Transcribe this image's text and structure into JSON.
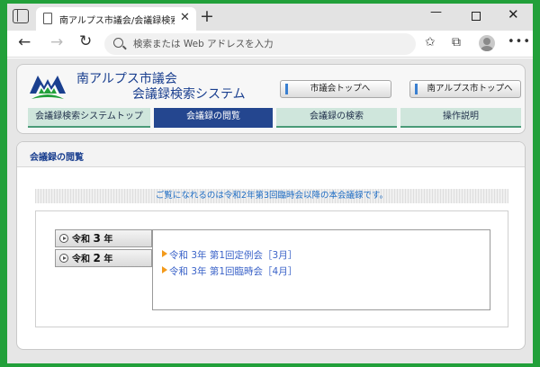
{
  "browser": {
    "tab_title": "南アルプス市議会/会議録検索シス…",
    "tab_close": "✕",
    "new_tab": "+",
    "win_min": "—",
    "win_close": "✕",
    "nav_back": "←",
    "nav_forward": "→",
    "nav_reload": "↻",
    "address_placeholder": "検索または Web アドレスを入力",
    "favorites_icon": "✩",
    "collections_icon": "⧉",
    "more_icon": "•••"
  },
  "site": {
    "title_line1": "南アルプス市議会",
    "title_line2": "会議録検索システム",
    "btn_council_top": "市議会トップへ",
    "btn_city_top": "南アルプス市トップへ",
    "nav": [
      {
        "label": "会議録検索システムトップ",
        "active": false
      },
      {
        "label": "会議録の閲覧",
        "active": true
      },
      {
        "label": "会議録の検索",
        "active": false
      },
      {
        "label": "操作説明",
        "active": false
      }
    ]
  },
  "main": {
    "panel_title": "会議録の閲覧",
    "notice": "ご覧になれるのは令和2年第3回臨時会以降の本会議録です。",
    "years": [
      {
        "era": "令和",
        "num": "3",
        "suffix": "年"
      },
      {
        "era": "令和",
        "num": "2",
        "suffix": "年"
      }
    ],
    "sessions": [
      "令和 3年 第1回定例会［3月］",
      "令和 3年 第1回臨時会［4月］"
    ]
  },
  "colors": {
    "accent_blue": "#24468f",
    "link_blue": "#3a62c8",
    "tab_green": "#cfe6dc",
    "bullet_orange": "#f39a1b"
  }
}
